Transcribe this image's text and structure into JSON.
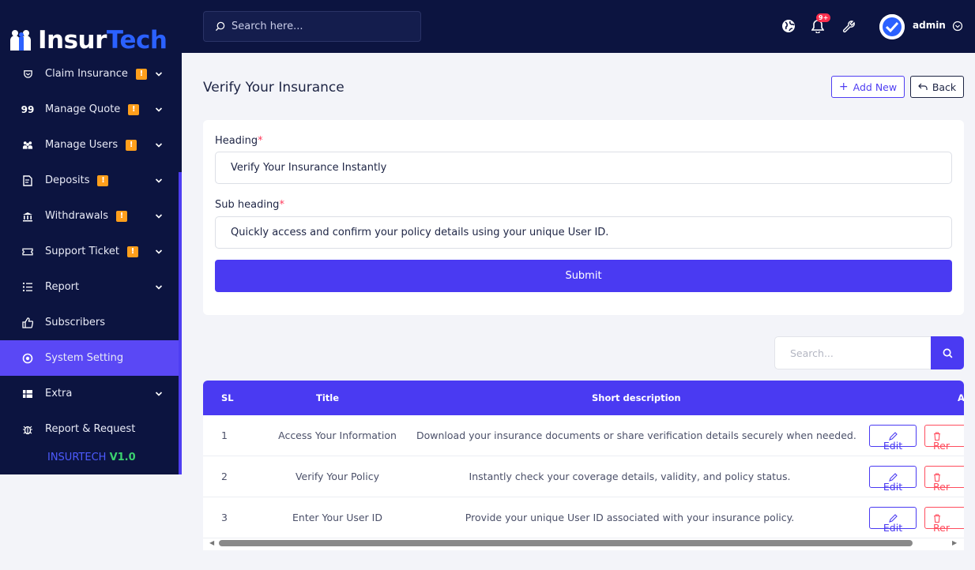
{
  "brand": {
    "name_part1": "Insur",
    "name_part2": "Tech"
  },
  "sidebar": {
    "items": [
      {
        "label": "Claim Insurance",
        "icon": "shield-icon",
        "badge": "!",
        "chevron": true,
        "active": false
      },
      {
        "label": "Manage Quote",
        "icon": "quote-icon",
        "badge": "!",
        "chevron": true,
        "active": false
      },
      {
        "label": "Manage Users",
        "icon": "users-icon",
        "badge": "!",
        "chevron": true,
        "active": false
      },
      {
        "label": "Deposits",
        "icon": "receipt-icon",
        "badge": "!",
        "chevron": true,
        "active": false
      },
      {
        "label": "Withdrawals",
        "icon": "bank-icon",
        "badge": "!",
        "chevron": true,
        "active": false
      },
      {
        "label": "Support Ticket",
        "icon": "ticket-icon",
        "badge": "!",
        "chevron": true,
        "active": false
      },
      {
        "label": "Report",
        "icon": "list-icon",
        "badge": "",
        "chevron": true,
        "active": false
      },
      {
        "label": "Subscribers",
        "icon": "thumbs-up-icon",
        "badge": "",
        "chevron": false,
        "active": false
      },
      {
        "label": "System Setting",
        "icon": "gear-icon",
        "badge": "",
        "chevron": false,
        "active": true
      },
      {
        "label": "Extra",
        "icon": "grid-icon",
        "badge": "",
        "chevron": true,
        "active": false
      },
      {
        "label": "Report & Request",
        "icon": "bug-icon",
        "badge": "",
        "chevron": false,
        "active": false
      }
    ],
    "version_prefix": "INSURTECH ",
    "version_number": "V1.0"
  },
  "topbar": {
    "search_placeholder": "Search here...",
    "notification_badge": "9+",
    "user_name": "admin"
  },
  "page": {
    "title": "Verify Your Insurance",
    "add_new_label": "Add New",
    "back_label": "Back"
  },
  "form": {
    "heading_label": "Heading",
    "heading_value": "Verify Your Insurance Instantly",
    "subheading_label": "Sub heading",
    "subheading_value": "Quickly access and confirm your policy details using your unique User ID.",
    "required_mark": "*",
    "submit_label": "Submit"
  },
  "table": {
    "search_placeholder": "Search...",
    "headers": {
      "sl": "SL",
      "title": "Title",
      "description": "Short description",
      "action": "A"
    },
    "rows": [
      {
        "sl": "1",
        "title": "Access Your Information",
        "description": "Download your insurance documents or share verification details securely when needed.",
        "edit_label": "Edit",
        "remove_label": "Rer"
      },
      {
        "sl": "2",
        "title": "Verify Your Policy",
        "description": "Instantly check your coverage details, validity, and policy status.",
        "edit_label": "Edit",
        "remove_label": "Rer"
      },
      {
        "sl": "3",
        "title": "Enter Your User ID",
        "description": "Provide your unique User ID associated with your insurance policy.",
        "edit_label": "Edit",
        "remove_label": "Rer"
      }
    ]
  },
  "colors": {
    "sidebar_bg": "#0c1440",
    "accent": "#4a3af2",
    "badge": "#ff9f1c",
    "danger": "#ff4d5e",
    "version_green": "#3bd16f"
  }
}
